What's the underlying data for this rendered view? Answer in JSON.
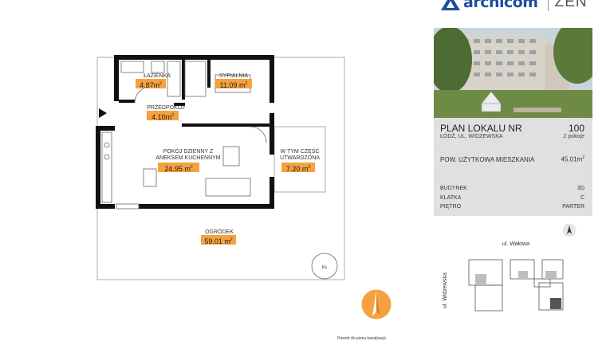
{
  "header": {
    "brand_name": "archicom",
    "project_name": "ZEN"
  },
  "floor_plan": {
    "rooms": [
      {
        "name": "ŁAZIENKA",
        "area": "4.87m",
        "unit": "2"
      },
      {
        "name": "SYPIALNIA",
        "area": "11.09 m",
        "unit": "2"
      },
      {
        "name": "PRZEDPOKÓJ",
        "area": "4.10m",
        "unit": "2"
      },
      {
        "name_line1": "POKÓJ DZIENNY Z",
        "name_line2": "ANEKSEM KUCHENNYM",
        "area": "24.95 m",
        "unit": "2"
      },
      {
        "name_line1": "W TYM CZĘŚĆ",
        "name_line2": "UTWARDZONA",
        "area": "7.20 m",
        "unit": "2"
      },
      {
        "name": "OGRÓDEK",
        "area": "59.01 m",
        "unit": "2"
      }
    ],
    "ks_label": "ks",
    "accent_color": "#f5a23e"
  },
  "details": {
    "plan_title": "PLAN LOKALU NR",
    "unit_number": "100",
    "address": "ŁÓDŹ, UL. WIDZEWSKA",
    "rooms_count": "2 pokoje",
    "area_label": "POW. UŻYTKOWA MIESZKANIA",
    "area_value": "45.01m",
    "area_unit": "2",
    "building_label": "BUDYNEK",
    "building_value": "3D",
    "stair_label": "KLATKA",
    "stair_value": "C",
    "floor_label": "PIĘTRO",
    "floor_value": "PARTER"
  },
  "site_map": {
    "street_top": "ul.   Wałowa",
    "street_left": "ul.  Widzewska"
  },
  "footer": {
    "note": "Powrót do pionu kanalizacji"
  }
}
